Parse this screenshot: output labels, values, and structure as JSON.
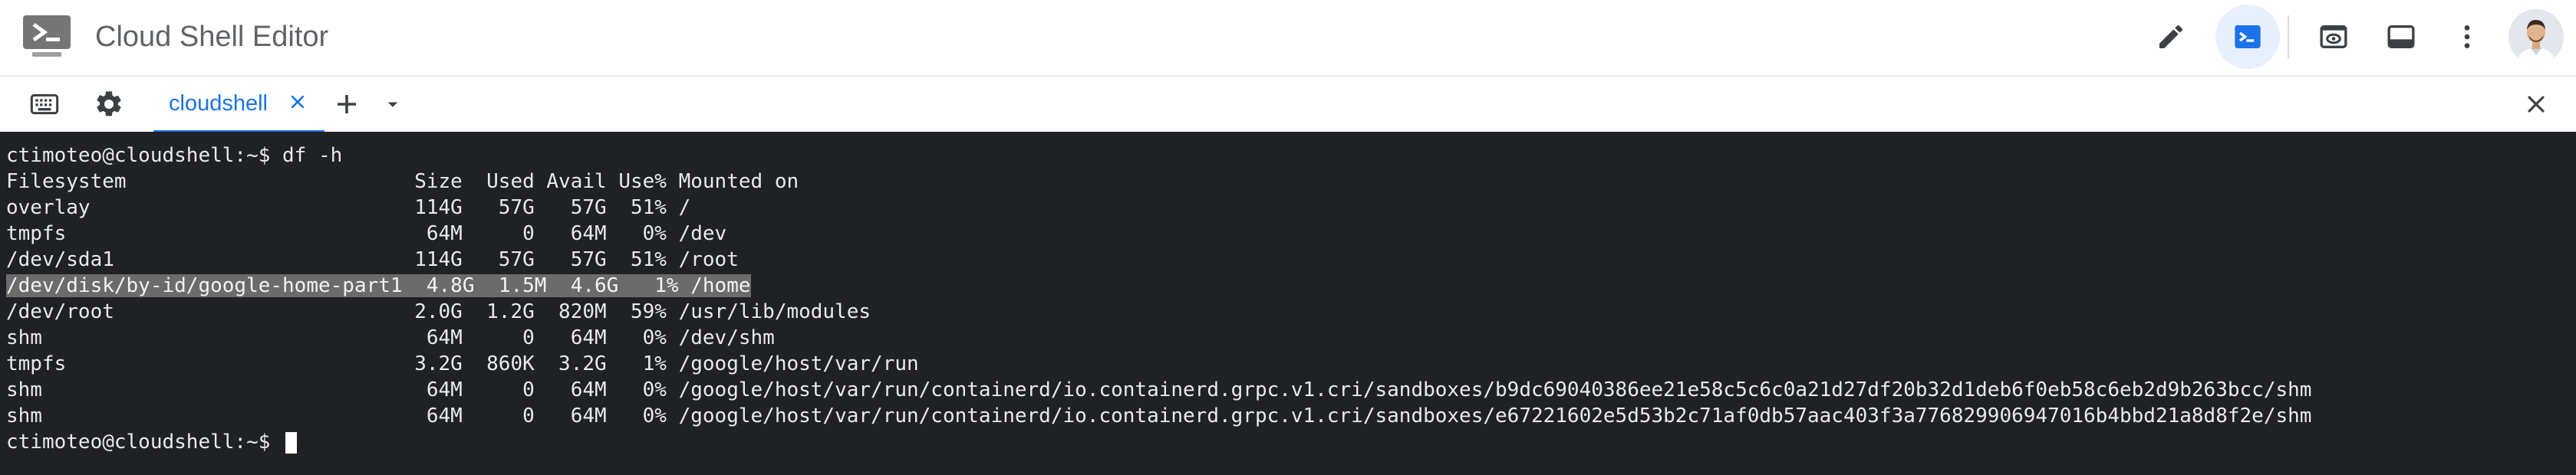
{
  "app": {
    "title": "Cloud Shell Editor"
  },
  "header_icons": {
    "logo": "terminal-logo-icon",
    "edit": "pencil-icon",
    "terminal": "terminal-icon",
    "preview": "web-preview-icon",
    "layout": "panel-layout-icon",
    "more": "more-vert-icon",
    "avatar": "user-avatar"
  },
  "tabbar": {
    "keyboard_icon": "keyboard-icon",
    "settings_icon": "gear-icon",
    "tab_label": "cloudshell",
    "add_icon": "plus-icon",
    "dropdown_icon": "caret-down-icon",
    "close_icon": "close-icon"
  },
  "colors": {
    "accent": "#1a73e8",
    "terminal_bg": "#202124",
    "terminal_fg": "#e8eaed",
    "highlight_bg": "#6b6b6b"
  },
  "terminal": {
    "prompt": "ctimoteo@cloudshell:~$ ",
    "command": "df -h",
    "header": "Filesystem                        Size  Used Avail Use% Mounted on",
    "rows": [
      "overlay                           114G   57G   57G  51% /",
      "tmpfs                              64M     0   64M   0% /dev",
      "/dev/sda1                         114G   57G   57G  51% /root",
      "/dev/disk/by-id/google-home-part1  4.8G  1.5M  4.6G   1% /home",
      "/dev/root                         2.0G  1.2G  820M  59% /usr/lib/modules",
      "shm                                64M     0   64M   0% /dev/shm",
      "tmpfs                             3.2G  860K  3.2G   1% /google/host/var/run",
      "shm                                64M     0   64M   0% /google/host/var/run/containerd/io.containerd.grpc.v1.cri/sandboxes/b9dc69040386ee21e58c5c6c0a21d27df20b32d1deb6f0eb58c6eb2d9b263bcc/shm",
      "shm                                64M     0   64M   0% /google/host/var/run/containerd/io.containerd.grpc.v1.cri/sandboxes/e67221602e5d53b2c71af0db57aac403f3a776829906947016b4bbd21a8d8f2e/shm"
    ],
    "highlighted_row_index": 3,
    "final_prompt": "ctimoteo@cloudshell:~$ "
  }
}
